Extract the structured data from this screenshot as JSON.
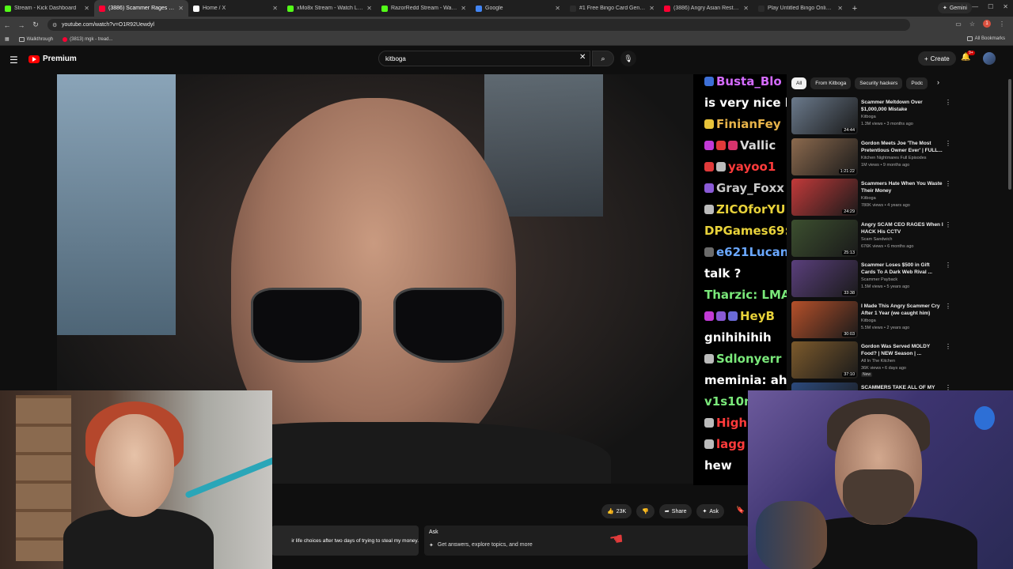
{
  "browser": {
    "tabs": [
      {
        "title": "Stream - Kick Dashboard",
        "color": "#53fc18"
      },
      {
        "title": "(3886) Scammer Rages Los",
        "color": "#ff0033",
        "active": true
      },
      {
        "title": "Home / X",
        "color": "#ffffff"
      },
      {
        "title": "xMo8x Stream - Watch Live on",
        "color": "#53fc18"
      },
      {
        "title": "RazorRedd Stream - Watch Liv",
        "color": "#53fc18"
      },
      {
        "title": "Google",
        "color": "#4285f4"
      },
      {
        "title": "#1 Free Bingo Card Generator",
        "color": "#2c2c2c"
      },
      {
        "title": "(3886) Angry Asian Restaurant",
        "color": "#ff0033"
      },
      {
        "title": "Play Untitled Bingo Online | Bin",
        "color": "#2c2c2c"
      }
    ],
    "gemini_label": "Gemini",
    "url": "youtube.com/watch?v=O1R92Uewdyl",
    "bookmarks": [
      "Walkthrough",
      "(3813) mgk - tread..."
    ],
    "all_bookmarks": "All Bookmarks"
  },
  "youtube": {
    "logo_text": "Premium",
    "search_value": "kitboga",
    "create_label": "Create",
    "notif_count": "9+",
    "actions": {
      "like_count": "23K",
      "share_label": "Share",
      "ask_label": "Ask"
    },
    "description_snippet": "ir life choices after two days of trying to steal my money.",
    "ask_card": {
      "title": "Ask",
      "prompt": "Get answers, explore topics, and more"
    },
    "chips": [
      "All",
      "From Kitboga",
      "Security hackers",
      "Podc"
    ],
    "recommendations": [
      {
        "title": "Scammer Meltdown Over $1,000,000 Mistake",
        "channel": "Kitboga",
        "meta": "1.3M views • 3 months ago",
        "duration": "24:44",
        "thumb": "#6b7a8c"
      },
      {
        "title": "Gordon Meets Joe 'The Most Pretentious Owner Ever' | FULL...",
        "channel": "Kitchen Nightmares Full Episodes",
        "meta": "1M views • 9 months ago",
        "duration": "1:21:22",
        "thumb": "#8c6a4e"
      },
      {
        "title": "Scammers Hate When You Waste Their Money",
        "channel": "Kitboga",
        "meta": "780K views • 4 years ago",
        "duration": "24:29",
        "thumb": "#c23a3a"
      },
      {
        "title": "Angry SCAM CEO RAGES When I HACK His CCTV",
        "channel": "Scam Sandwich",
        "meta": "676K views • 6 months ago",
        "duration": "25:13",
        "thumb": "#3c4f2f"
      },
      {
        "title": "Scammer Loses $500 in Gift Cards To A Dark Web Rival ...",
        "channel": "Scammer Payback",
        "meta": "1.5M views • 5 years ago",
        "duration": "33:38",
        "thumb": "#5a3f7c"
      },
      {
        "title": "I Made This Angry Scammer Cry After 1 Year (we caught him)",
        "channel": "Kitboga",
        "meta": "5.5M views • 2 years ago",
        "duration": "30:03",
        "thumb": "#b5502a"
      },
      {
        "title": "Gordon Was Served MOLDY Food? | NEW Season | ...",
        "channel": "All In The Kitchen",
        "meta": "36K views • 6 days ago",
        "duration": "37:10",
        "thumb": "#7c5a2c",
        "badge": "New"
      },
      {
        "title": "SCAMMERS TAKE ALL OF MY",
        "channel": "",
        "meta": "",
        "duration": "",
        "thumb": "#2c4a7c"
      }
    ]
  },
  "chat": [
    {
      "text": "Busta_Blo",
      "color": "#d46bff",
      "badges": [
        "#3d6fd6"
      ]
    },
    {
      "text": "is very nice h",
      "color": "#ffffff",
      "badges": []
    },
    {
      "text": "FinianFey",
      "color": "#e8b44a",
      "badges": [
        "#e8c33a"
      ]
    },
    {
      "text": "Vallic",
      "color": "#d8d8d8",
      "badges": [
        "#c23ad6",
        "#e03a3a",
        "#d6336c"
      ]
    },
    {
      "text": "yayoo1",
      "color": "#ff3b3b",
      "badges": [
        "#e03a3a",
        "#bbbbbb"
      ]
    },
    {
      "text": "Gray_Foxx",
      "color": "#c8c8c8",
      "badges": [
        "#8a5ad6"
      ]
    },
    {
      "text": "ZICOforYU",
      "color": "#e8d23a",
      "badges": [
        "#bbbbbb"
      ]
    },
    {
      "text": "DPGames69:",
      "color": "#e8d23a",
      "badges": []
    },
    {
      "text": "e621Lucan",
      "color": "#6aa8ff",
      "badges": [
        "#6b6b6b"
      ]
    },
    {
      "text": "talk ?",
      "color": "#ffffff",
      "badges": []
    },
    {
      "text": "Tharzic: LMA",
      "color": "#7ae87a",
      "badges": []
    },
    {
      "text": "HeyB",
      "color": "#e8d23a",
      "badges": [
        "#c23ad6",
        "#8a5ad6",
        "#6a6ad6"
      ]
    },
    {
      "text": "gnihihihih",
      "color": "#ffffff",
      "badges": []
    },
    {
      "text": "Sdlonyerr",
      "color": "#7ae87a",
      "badges": [
        "#bbbbbb"
      ]
    },
    {
      "text": "meminia: ah",
      "color": "#ffffff",
      "badges": []
    },
    {
      "text": "v1s10n",
      "color": "#7ae87a",
      "badges": []
    },
    {
      "text": "High",
      "color": "#ff3b3b",
      "badges": [
        "#bbbbbb"
      ]
    },
    {
      "text": "lagg",
      "color": "#ff3b3b",
      "badges": [
        "#bbbbbb"
      ]
    },
    {
      "text": "hew",
      "color": "#ffffff",
      "badges": []
    }
  ]
}
